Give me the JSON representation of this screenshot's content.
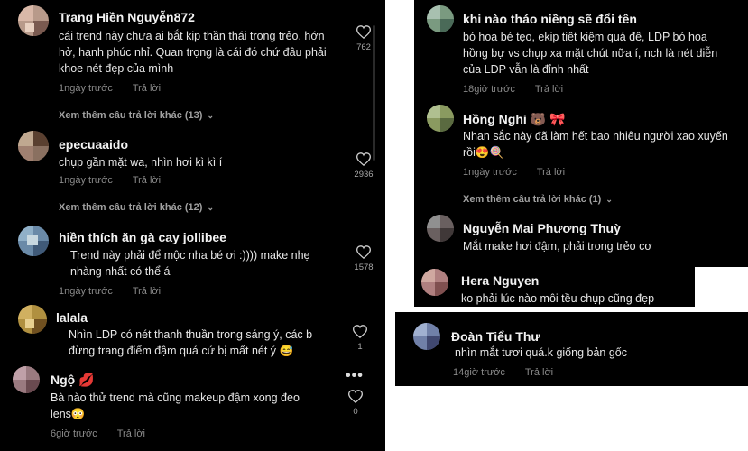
{
  "left_comments": [
    {
      "name": "Trang Hiền Nguyễn872",
      "lines": [
        "cái trend này chưa ai bắt kịp thần thái trong trẻo, hớn",
        "hở, hạnh phúc nhỉ. Quan trọng là cái đó chứ đâu phải",
        "khoe nét đẹp của mình"
      ],
      "time": "1ngày trước",
      "reply": "Trả lời",
      "likes": "762",
      "more": "Xem thêm câu trả lời khác (13)"
    },
    {
      "name": "epecuaaido",
      "lines": [
        "chụp gần mặt wa, nhìn hơi kì kì í"
      ],
      "time": "1ngày trước",
      "reply": "Trả lời",
      "likes": "2936",
      "more": "Xem thêm câu trả lời khác (12)"
    },
    {
      "name": "hiền thích ăn gà cay jollibee",
      "lines": [
        "Trend này phải để mộc nha bé ơi :)))) make nhẹ",
        "nhàng nhất có thể á"
      ],
      "time": "1ngày trước",
      "reply": "Trả lời",
      "likes": "1578"
    },
    {
      "name": "lalala",
      "lines": [
        "Nhìn LDP có nét thanh thuần trong sáng ý, các b",
        "đừng trang điểm đậm quá cứ bị mất nét ý 😅"
      ],
      "time": "",
      "reply": "",
      "likes": "1"
    },
    {
      "name": "Ngộ 💋",
      "lines": [
        "Bà nào thử trend mà cũng makeup đậm xong đeo",
        "lens😳"
      ],
      "time": "6giờ trước",
      "reply": "Trả lời",
      "likes": "0"
    }
  ],
  "right_comments": [
    {
      "name": "khi nào tháo niềng sẽ đổi tên",
      "lines": [
        "bó hoa bé tẹo, ekip tiết kiệm quá đê, LDP bó hoa",
        "hồng bự vs chụp xa mặt chút nữa í, nch là nét diễn",
        "của LDP vẫn là đỉnh nhất"
      ],
      "time": "18giờ trước",
      "reply": "Trả lời"
    },
    {
      "name": "Hồng Nghi 🐻 🎀",
      "lines": [
        "Nhan sắc này đã làm hết bao nhiêu người xao xuyến",
        "rồi😍🍭"
      ],
      "time": "1ngày trước",
      "reply": "Trả lời",
      "more": "Xem thêm câu trả lời khác (1)"
    },
    {
      "name": "Nguyễn Mai Phương Thuỳ",
      "lines": [
        "Mắt make hơi đậm, phải trong trẻo cơ"
      ]
    },
    {
      "name": "Hera Nguyen",
      "lines": [
        "ko phải lúc nào môi tều chụp cũng đẹp"
      ]
    },
    {
      "name": "Đoàn Tiểu Thư",
      "lines": [
        "nhìn mắt tươi quá.k giống bản gốc"
      ],
      "time": "14giờ trước",
      "reply": "Trả lời"
    }
  ],
  "more_icon": "chevron-down-icon",
  "like_icon": "heart-icon",
  "menu_icon": "more-options-icon"
}
